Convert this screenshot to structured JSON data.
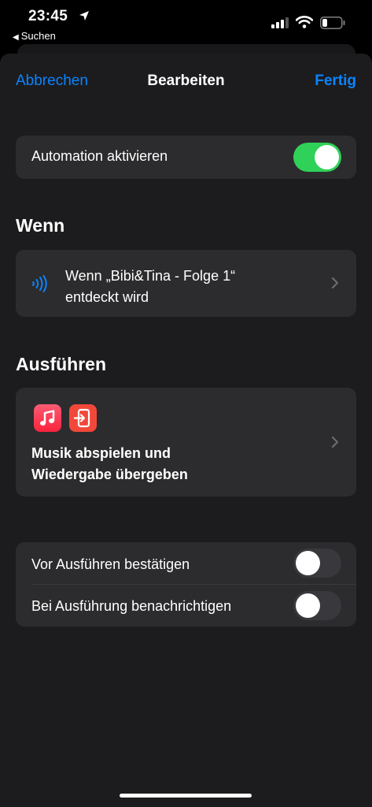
{
  "status_bar": {
    "time": "23:45",
    "back_app": "Suchen",
    "icons": [
      "location-arrow-icon",
      "cellular-signal-icon",
      "wifi-icon",
      "battery-icon"
    ]
  },
  "nav": {
    "cancel": "Abbrechen",
    "title": "Bearbeiten",
    "done": "Fertig"
  },
  "automation": {
    "label": "Automation aktivieren",
    "enabled": true
  },
  "when": {
    "title": "Wenn",
    "trigger_line1": "Wenn „Bibi&Tina - Folge 1“",
    "trigger_line2": "entdeckt wird",
    "icon": "nfc-icon"
  },
  "execute": {
    "title": "Ausführen",
    "icons": [
      "music-app-icon",
      "handoff-icon"
    ],
    "action_line1": "Musik abspielen und",
    "action_line2": "Wiedergabe übergeben"
  },
  "options": [
    {
      "label": "Vor Ausführen bestätigen",
      "enabled": false
    },
    {
      "label": "Bei Ausführung benachrichtigen",
      "enabled": false
    }
  ],
  "colors": {
    "accent": "#0a84ff",
    "toggle_on": "#30d158",
    "background": "#1c1c1e",
    "card": "#2c2c2e"
  }
}
